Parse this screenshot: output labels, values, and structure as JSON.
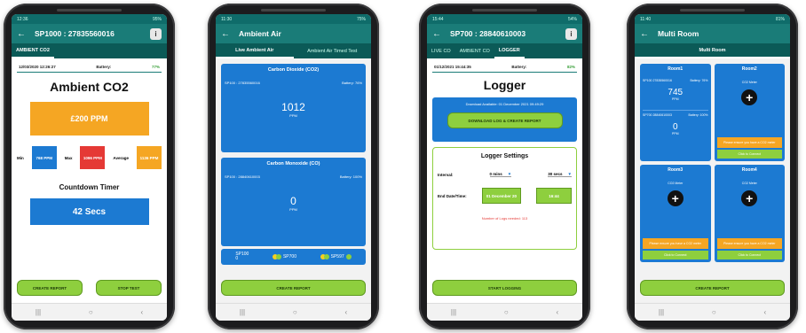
{
  "phones": {
    "p1": {
      "status_time": "12:36",
      "status_right": "95%",
      "title": "SP1000 : 27835560016",
      "tab": "AMBIENT CO2",
      "date": "12/03/2020 12:26:27",
      "battery_label": "Battery:",
      "battery_value": "77%",
      "heading": "Ambient CO2",
      "reading": "£200 PPM",
      "min_label": "Min",
      "min_value": "768 PPM",
      "max_label": "Max",
      "max_value": "1096 PPM",
      "avg_label": "Average",
      "avg_value": "1136 PPM",
      "timer_heading": "Countdown Timer",
      "timer_value": "42 Secs",
      "btn_create": "CREATE REPORT",
      "btn_stop": "STOP TEST"
    },
    "p2": {
      "status_time": "11:30",
      "status_right": "75%",
      "title": "Ambient Air",
      "tab1": "Live Ambient Air",
      "tab2": "Ambient Air Timed Test",
      "card1_title": "Carbon Dioxide (CO2)",
      "card1_left": "SP100 : 27835560016",
      "card1_right": "Battery: 76%",
      "card1_value": "1012",
      "card1_unit": "PPM",
      "card2_title": "Carbon Monoxide (CO)",
      "card2_left": "SP100 : 28840610003",
      "card2_right": "Battery: 100%",
      "card2_value": "0",
      "card2_unit": "PPM",
      "legend1": "SP100",
      "legend1b": "0",
      "legend2": "SP700",
      "legend3": "SP597",
      "btn_create": "CREATE REPORT"
    },
    "p3": {
      "status_time": "15:44",
      "status_right": "54%",
      "title": "SP700 : 28840610003",
      "tab1": "LIVE CO",
      "tab2": "AMBIENT CO",
      "tab3": "LOGGER",
      "date": "01/12/2021 15:44:35",
      "battery_label": "Battery:",
      "battery_value": "82%",
      "heading": "Logger",
      "download_text": "Download Available: 01 December 2021 09:49:29",
      "btn_download": "DOWNLOAD LOG & CREATE REPORT",
      "settings_heading": "Logger Settings",
      "interval_label": "Interval:",
      "mins_value": "0 mins",
      "secs_value": "30 secs",
      "end_label": "End Date/Time:",
      "end_date": "01 December 20",
      "end_time": "16:44",
      "note": "Number of Logs needed: 113",
      "btn_start": "START LOGGING"
    },
    "p4": {
      "status_time": "11:40",
      "status_right": "81%",
      "title": "Multi Room",
      "tab": "Multi Room",
      "room1": "Room1",
      "room1_sensor1": "SP100 27835560016",
      "room1_batt1": "Battery: 76%",
      "room1_value1": "745",
      "room1_unit1": "PPM",
      "room1_sensor2": "SP700 28840610003",
      "room1_batt2": "Battery: 100%",
      "room1_value2": "0",
      "room1_unit2": "PPM",
      "room2": "Room2",
      "room2_meter": "CO2 Meter",
      "room2_orange": "Please ensure you have a CO2 meter",
      "room2_green": "Click to Connect",
      "room3": "Room3",
      "room3_meter": "CO2 Meter",
      "room3_orange": "Please ensure you have a CO2 meter",
      "room3_green": "Click to Connect",
      "room4": "Room4",
      "room4_meter": "CO2 Meter",
      "room4_orange": "Please ensure you have a CO2 meter",
      "room4_green": "Click to Connect",
      "btn_create": "CREATE REPORT"
    }
  },
  "nav": {
    "recent": "|||",
    "home": "○",
    "back": "‹"
  },
  "colors": {
    "teal": "#1a7c78",
    "blue": "#1c7ad2",
    "green": "#8ecf3e",
    "orange": "#f5a623",
    "red": "#e53935"
  }
}
